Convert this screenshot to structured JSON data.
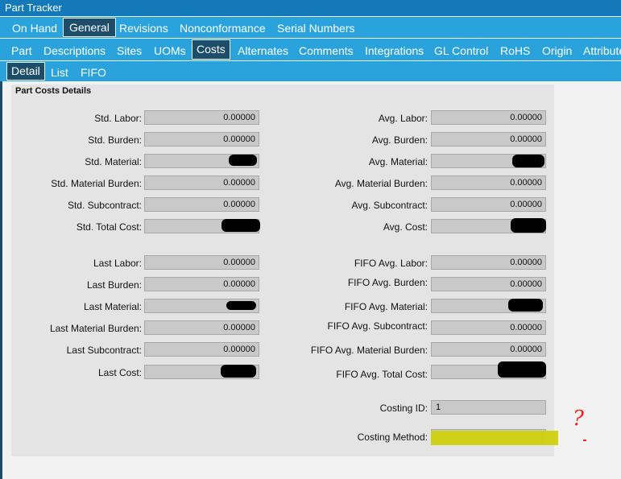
{
  "window": {
    "title": "Part Tracker"
  },
  "tabs_row1": [
    "On Hand",
    "General",
    "Revisions",
    "Nonconformance",
    "Serial Numbers"
  ],
  "tabs_row2": [
    "Part",
    "Descriptions",
    "Sites",
    "UOMs",
    "Costs",
    "Alternates",
    "Comments",
    "Integrations",
    "GL Control",
    "RoHS",
    "Origin",
    "Attribute"
  ],
  "tabs_row3": [
    "Detail",
    "List",
    "FIFO"
  ],
  "panel": {
    "title": "Part Costs Details"
  },
  "std": {
    "labor": {
      "label": "Std. Labor:",
      "value": "0.00000"
    },
    "burden": {
      "label": "Std. Burden:",
      "value": "0.00000"
    },
    "material": {
      "label": "Std. Material:",
      "value": ""
    },
    "material_burden": {
      "label": "Std. Material Burden:",
      "value": "0.00000"
    },
    "subcontract": {
      "label": "Std. Subcontract:",
      "value": "0.00000"
    },
    "total_cost": {
      "label": "Std. Total Cost:",
      "value": ""
    }
  },
  "avg": {
    "labor": {
      "label": "Avg. Labor:",
      "value": "0.00000"
    },
    "burden": {
      "label": "Avg. Burden:",
      "value": "0.00000"
    },
    "material": {
      "label": "Avg. Material:",
      "value": ""
    },
    "material_burden": {
      "label": "Avg. Material Burden:",
      "value": "0.00000"
    },
    "subcontract": {
      "label": "Avg. Subcontract:",
      "value": "0.00000"
    },
    "cost": {
      "label": "Avg. Cost:",
      "value": ""
    }
  },
  "last": {
    "labor": {
      "label": "Last Labor:",
      "value": "0.00000"
    },
    "burden": {
      "label": "Last Burden:",
      "value": "0.00000"
    },
    "material": {
      "label": "Last Material:",
      "value": ""
    },
    "material_burden": {
      "label": "Last Material Burden:",
      "value": "0.00000"
    },
    "subcontract": {
      "label": "Last Subcontract:",
      "value": "0.00000"
    },
    "cost": {
      "label": "Last Cost:",
      "value": ""
    }
  },
  "fifo": {
    "labor": {
      "label": "FIFO Avg. Labor:",
      "value": "0.00000"
    },
    "burden": {
      "label": "FIFO Avg. Burden:",
      "value": "0.00000"
    },
    "material": {
      "label": "FIFO Avg. Material:",
      "value": ""
    },
    "subcontract": {
      "label": "FIFO Avg. Subcontract:",
      "value": "0.00000"
    },
    "material_burden": {
      "label": "FIFO Avg. Material Burden:",
      "value": "0.00000"
    },
    "total_cost": {
      "label": "FIFO Avg. Total Cost:",
      "value": ""
    }
  },
  "costing": {
    "id": {
      "label": "Costing ID:",
      "value": "1"
    },
    "method": {
      "label": "Costing Method:",
      "value": ""
    }
  },
  "annotation": {
    "mark": "?"
  },
  "colors": {
    "titlebar": "#1479b8",
    "tabbar": "#2aa3dd",
    "active_tab": "#1c4e6b",
    "highlight": "#cfd00e",
    "annotation": "#ff1e1e"
  }
}
